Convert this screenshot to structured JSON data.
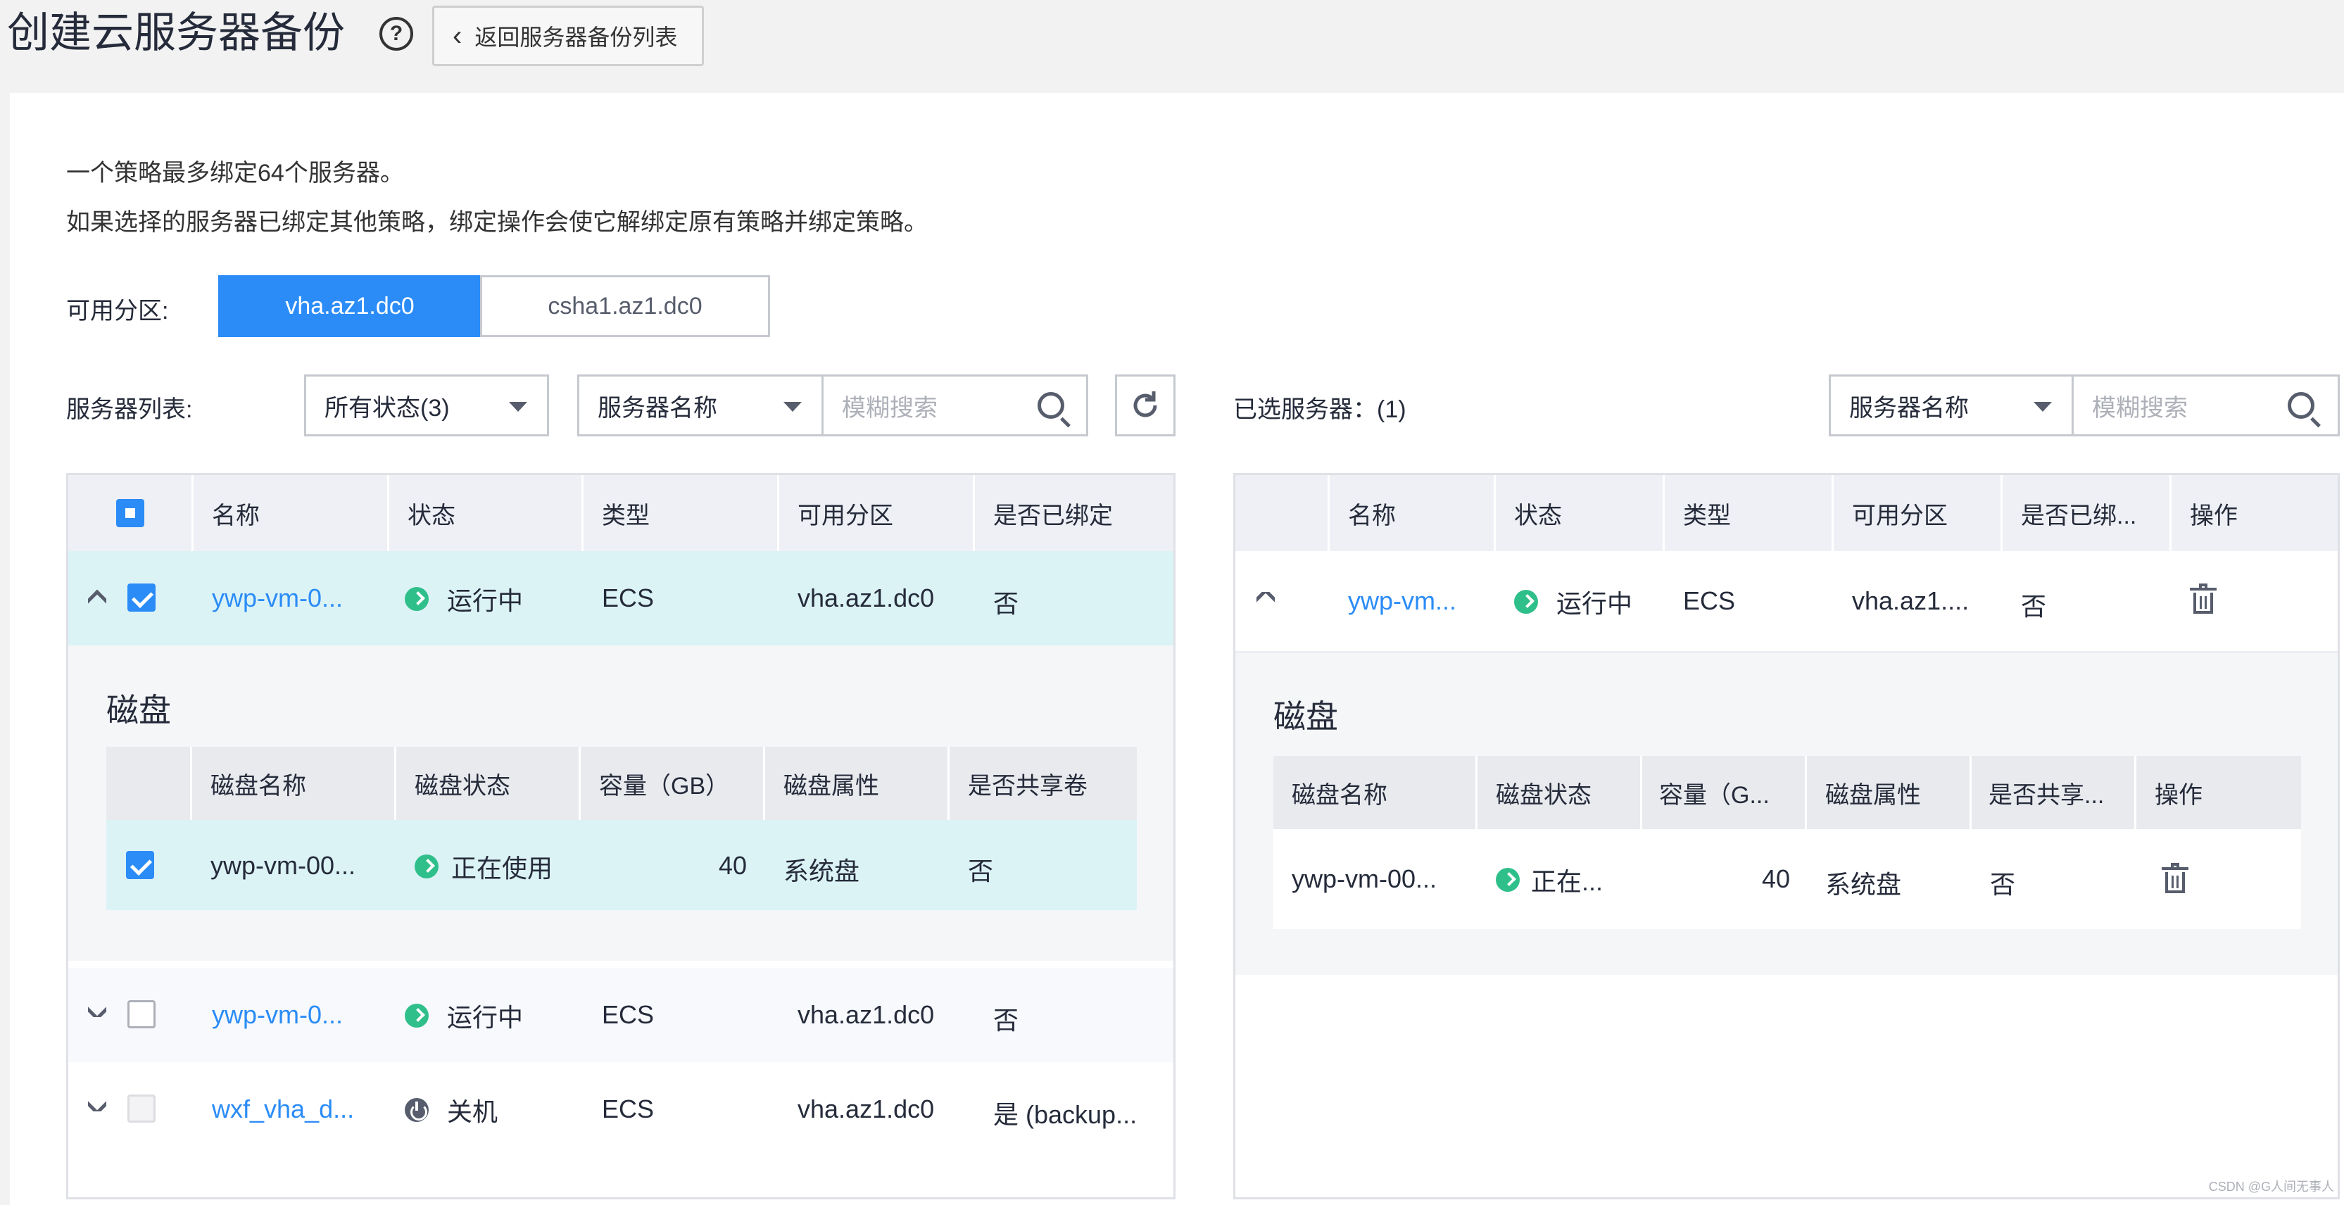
{
  "header": {
    "title": "创建云服务器备份",
    "help_icon": "?",
    "back_label": "返回服务器备份列表"
  },
  "notes": [
    "一个策略最多绑定64个服务器。",
    "如果选择的服务器已绑定其他策略，绑定操作会使它解绑定原有策略并绑定策略。"
  ],
  "az": {
    "label": "可用分区:",
    "tabs": [
      "vha.az1.dc0",
      "csha1.az1.dc0"
    ],
    "selected": "vha.az1.dc0"
  },
  "server_list": {
    "label": "服务器列表:",
    "status_filter": "所有状态(3)",
    "search_field": "服务器名称",
    "search_placeholder": "模糊搜索",
    "columns": [
      "名称",
      "状态",
      "类型",
      "可用分区",
      "是否已绑定"
    ],
    "rows": [
      {
        "name": "ywp-vm-0...",
        "status": "运行中",
        "type": "ECS",
        "az": "vha.az1.dc0",
        "bound": "否"
      },
      {
        "name": "ywp-vm-0...",
        "status": "运行中",
        "type": "ECS",
        "az": "vha.az1.dc0",
        "bound": "否"
      },
      {
        "name": "wxf_vha_d...",
        "status": "关机",
        "type": "ECS",
        "az": "vha.az1.dc0",
        "bound": "是 (backup..."
      }
    ],
    "disk": {
      "title": "磁盘",
      "columns": [
        "磁盘名称",
        "磁盘状态",
        "容量（GB）",
        "磁盘属性",
        "是否共享卷"
      ],
      "rows": [
        {
          "name": "ywp-vm-00...",
          "status": "正在使用",
          "capacity": "40",
          "attr": "系统盘",
          "shared": "否"
        }
      ]
    }
  },
  "selected_servers": {
    "label": "已选服务器：(1)",
    "search_field": "服务器名称",
    "search_placeholder": "模糊搜索",
    "columns": [
      "名称",
      "状态",
      "类型",
      "可用分区",
      "是否已绑...",
      "操作"
    ],
    "rows": [
      {
        "name": "ywp-vm...",
        "status": "运行中",
        "type": "ECS",
        "az": "vha.az1....",
        "bound": "否"
      }
    ],
    "disk": {
      "title": "磁盘",
      "columns": [
        "磁盘名称",
        "磁盘状态",
        "容量（G...",
        "磁盘属性",
        "是否共享...",
        "操作"
      ],
      "rows": [
        {
          "name": "ywp-vm-00...",
          "status": "正在...",
          "capacity": "40",
          "attr": "系统盘",
          "shared": "否"
        }
      ]
    }
  },
  "watermark": "CSDN @G人间无事人",
  "colors": {
    "accent": "#2b8cf7",
    "running": "#2fbf8a",
    "selected_row": "#dcf3f6"
  }
}
